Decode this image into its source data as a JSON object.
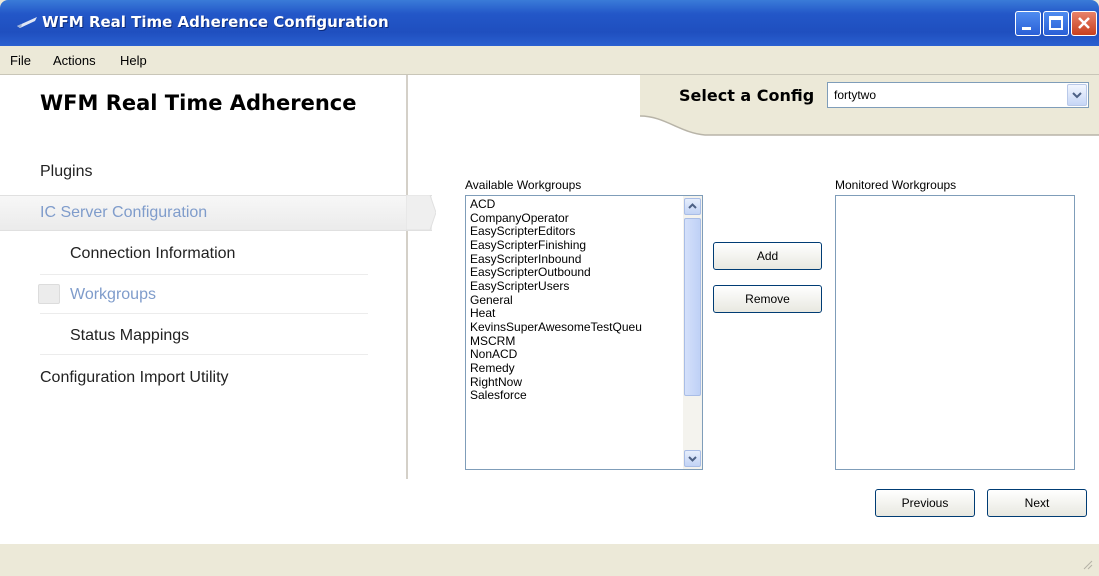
{
  "window": {
    "title": "WFM Real Time Adherence Configuration"
  },
  "menu": [
    "File",
    "Actions",
    "Help"
  ],
  "sidebar": {
    "heading": "WFM Real Time Adherence",
    "items": [
      {
        "label": "Plugins"
      },
      {
        "label": "IC Server Configuration",
        "selected": true
      },
      {
        "label": "Connection Information"
      },
      {
        "label": "Workgroups",
        "selected": true
      },
      {
        "label": "Status Mappings"
      },
      {
        "label": "Configuration Import Utility"
      }
    ]
  },
  "config": {
    "label": "Select a Config",
    "selected": "fortytwo"
  },
  "available": {
    "label": "Available Workgroups",
    "items": [
      "ACD",
      "CompanyOperator",
      "EasyScripterEditors",
      "EasyScripterFinishing",
      "EasyScripterInbound",
      "EasyScripterOutbound",
      "EasyScripterUsers",
      "General",
      "Heat",
      "KevinsSuperAwesomeTestQueu",
      "MSCRM",
      "NonACD",
      "Remedy",
      "RightNow",
      "Salesforce"
    ]
  },
  "monitored": {
    "label": "Monitored Workgroups",
    "items": []
  },
  "buttons": {
    "add": "Add",
    "remove": "Remove",
    "previous": "Previous",
    "next": "Next"
  },
  "colors": {
    "titlebar": "#2357c8",
    "selected_nav": "#7f9ccb",
    "button_border": "#003c74"
  }
}
